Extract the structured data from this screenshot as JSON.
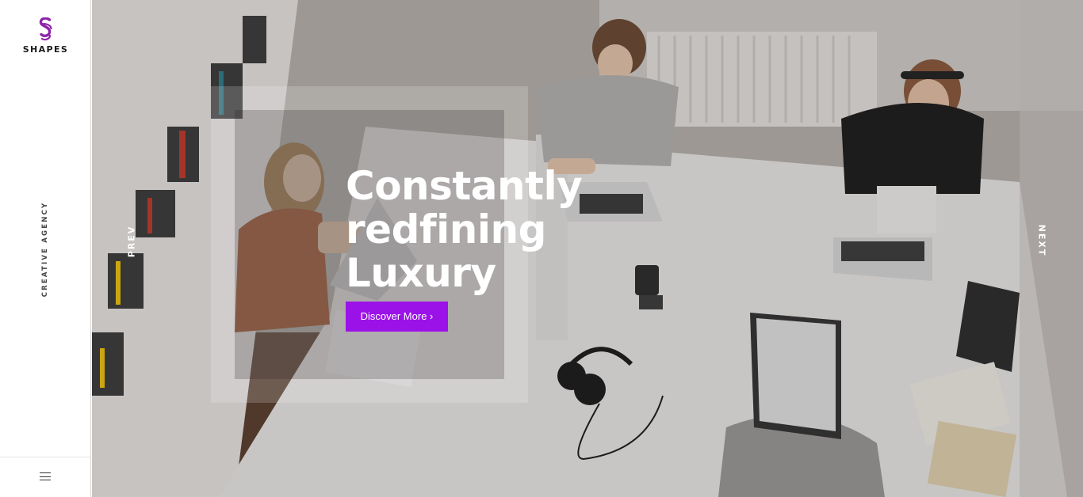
{
  "brand": {
    "logo_text": "SHAPES",
    "tagline": "CREATIVE AGENCY",
    "accent": "#9b12e8"
  },
  "hero": {
    "headline_lines": [
      "Constantly",
      "redfining",
      "Luxury"
    ],
    "cta_label": "Discover More ›",
    "prev_label": "PREV",
    "next_label": "NEXT"
  },
  "menu": {
    "icon": "hamburger-menu-icon"
  }
}
